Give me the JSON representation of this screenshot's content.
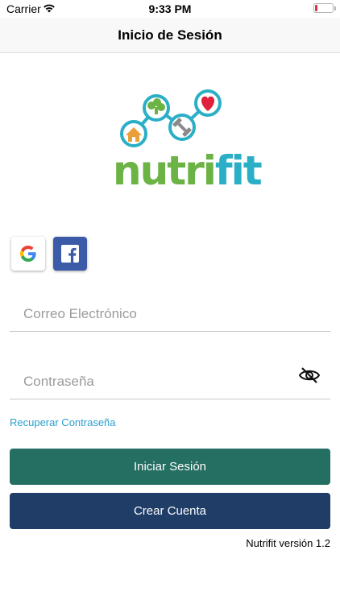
{
  "status_bar": {
    "carrier": "Carrier",
    "time": "9:33 PM",
    "wifi_icon": "wifi-icon",
    "battery_icon": "battery-low-icon",
    "battery_color": "#e0353a"
  },
  "nav": {
    "title": "Inicio de Sesión"
  },
  "logo": {
    "word_primary": "nutri",
    "word_accent": "fit",
    "primary_color": "#6bb344",
    "accent_color": "#2bafc7"
  },
  "social": {
    "google_icon": "google-icon",
    "facebook_icon": "facebook-icon",
    "facebook_color": "#3b5ba8"
  },
  "form": {
    "email_placeholder": "Correo Electrónico",
    "email_value": "",
    "password_placeholder": "Contraseña",
    "password_value": "",
    "toggle_icon": "eye-slash-icon"
  },
  "links": {
    "recover": "Recuperar Contraseña",
    "link_color": "#2a9fd0"
  },
  "buttons": {
    "login": "Iniciar Sesión",
    "login_color": "#256e62",
    "create": "Crear Cuenta",
    "create_color": "#1f3d66"
  },
  "footer": {
    "version": "Nutrifit versión 1.2"
  }
}
